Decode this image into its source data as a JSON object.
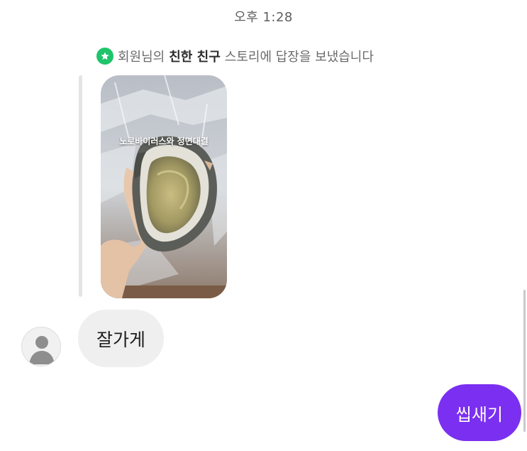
{
  "timestamp": "오후 1:28",
  "story_reply": {
    "icon": "star-icon",
    "icon_color": "#1fc46b",
    "prefix": "회원님의",
    "audience": "친한 친구",
    "suffix": "스토리에 답장을 보냈습니다"
  },
  "story": {
    "caption": "노로바이러스와 정면대결"
  },
  "messages": [
    {
      "direction": "incoming",
      "text": "잘가게"
    },
    {
      "direction": "outgoing",
      "text": "씹새기"
    }
  ],
  "colors": {
    "outgoing_bubble": "#7b2ff0",
    "incoming_bubble": "#efefef"
  }
}
